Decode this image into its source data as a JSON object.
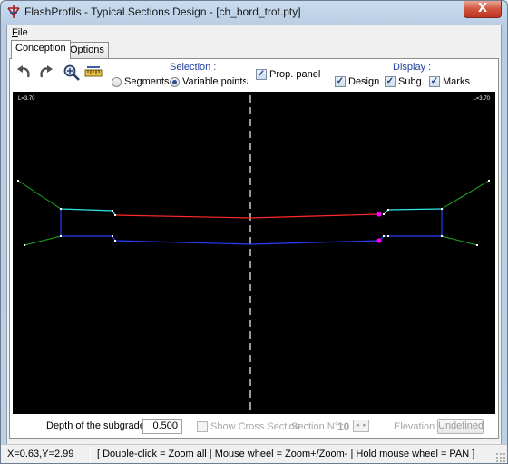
{
  "window": {
    "title": "FlashProfils - Typical Sections Design - [ch_bord_trot.pty]",
    "close_label": "X"
  },
  "menu": {
    "file_underlined": "F",
    "file_rest": "ile"
  },
  "tabs": [
    {
      "label": "Conception",
      "active": true
    },
    {
      "label": "Options",
      "active": false
    }
  ],
  "toolbar": {
    "icons": [
      "undo-icon",
      "redo-icon",
      "zoom-icon",
      "measure-icon"
    ],
    "selection": {
      "title": "Selection :",
      "segments": "Segments",
      "variable_points": "Variable points",
      "selected": "Variable points"
    },
    "prop_panel": {
      "label": "Prop. panel",
      "checked": true
    },
    "display": {
      "title": "Display :",
      "design": {
        "label": "Design",
        "checked": true
      },
      "subg": {
        "label": "Subg.",
        "checked": true
      },
      "marks": {
        "label": "Marks",
        "checked": true
      }
    }
  },
  "canvas": {
    "left_label": "L=3.70",
    "right_label": "L=3.70",
    "colors": {
      "background": "#000000",
      "design_line": "#ff2a2a",
      "subgrade_line": "#2a3cff",
      "curb": "#2ee6e6",
      "slope": "#22aa22",
      "axis": "#ffffff",
      "marker": "#ff00ff"
    }
  },
  "bottom": {
    "depth_label": "Depth of the subgrade :",
    "depth_value": "0.500",
    "show_cross_section": "Show Cross Section",
    "show_cross_section_checked": false,
    "section_label": "Section N° :",
    "section_number": "10",
    "elevation_label": "Elevation :",
    "elevation_value": "Undefined"
  },
  "status": {
    "coords": "X=0.63,Y=2.99",
    "help": "[ Double-click = Zoom all | Mouse wheel = Zoom+/Zoom- | Hold mouse wheel = PAN ]"
  }
}
